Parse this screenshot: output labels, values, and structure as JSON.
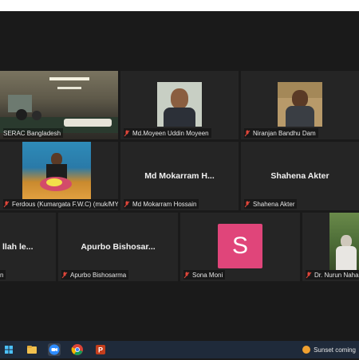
{
  "participants": [
    {
      "name": "SERAC Bangladesh",
      "tile_text": ""
    },
    {
      "name": "Md.Moyeen Uddin Moyeen",
      "tile_text": ""
    },
    {
      "name": "Niranjan Bandhu Dam",
      "tile_text": ""
    },
    {
      "name": "Ferdous (Kumargata F.W.C) (muk/MYM)",
      "tile_text": ""
    },
    {
      "name": "Md Mokarram Hossain",
      "tile_text": "Md Mokarram H..."
    },
    {
      "name": "Shahena Akter",
      "tile_text": "Shahena Akter"
    },
    {
      "name": "n",
      "tile_text": "llah le..."
    },
    {
      "name": "Apurbo Bishosarma",
      "tile_text": "Apurbo Bishosar..."
    },
    {
      "name": "Sona Moni",
      "tile_text": "",
      "avatar_letter": "S"
    },
    {
      "name": "Dr. Nurun Nahar",
      "tile_text": ""
    }
  ],
  "taskbar": {
    "weather_text": "Sunset coming",
    "icons": [
      "start-icon",
      "file-explorer-icon",
      "mail-icon",
      "zoom-icon",
      "chrome-icon",
      "powerpoint-icon"
    ]
  },
  "colors": {
    "active_speaker": "#c9e265",
    "avatar_pink": "#e0457a",
    "mic_muted": "#e0463a"
  }
}
